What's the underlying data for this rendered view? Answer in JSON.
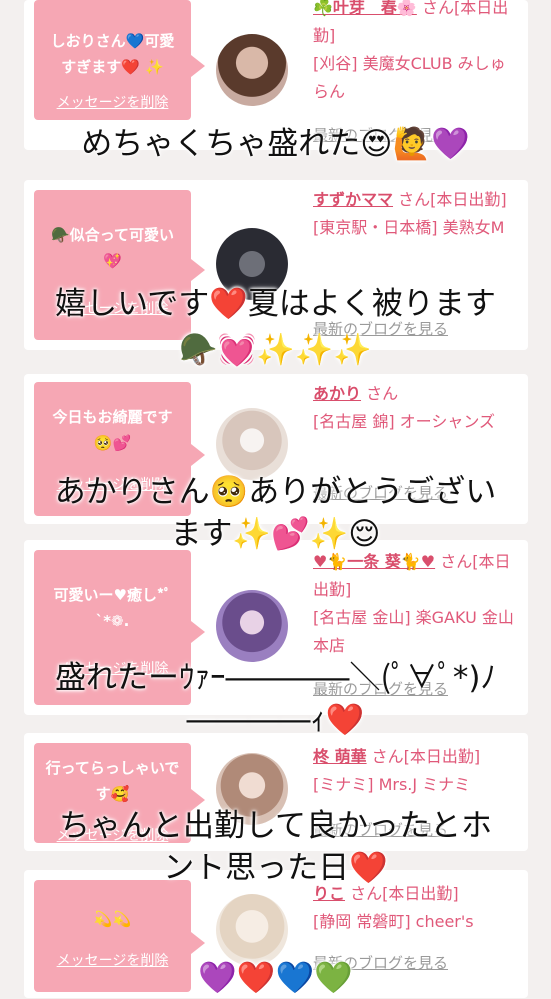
{
  "cards": [
    {
      "message": "しおりさん💙可愛すぎます❤️ ✨",
      "delete_label": "メッセージを削除",
      "name": "☘️叶芽　春🌸",
      "san": "さん[本日出勤]",
      "shop": "[刈谷] 美魔女CLUB みしゅらん",
      "blog_label": "最新のブログを見る"
    },
    {
      "message": "🪖似合って可愛い💖",
      "delete_label": "メッセージを削除",
      "name": "すずかママ",
      "san": "さん[本日出勤]",
      "shop": "[東京駅・日本橋] 美熟女M",
      "blog_label": "最新のブログを見る"
    },
    {
      "message": "今日もお綺麗です🥺💕",
      "delete_label": "メッセージを削除",
      "name": "あかり",
      "san": "さん",
      "shop": "[名古屋 錦] オーシャンズ",
      "blog_label": "最新のブログを見る"
    },
    {
      "message": "可愛いー♥癒し*ﾟ`*❁.",
      "delete_label": "メッセージを削除",
      "name": "♥🐈一条 葵🐈♥",
      "san": "さん[本日出勤]",
      "shop": "[名古屋 金山] 楽GAKU 金山本店",
      "blog_label": "最新のブログを見る"
    },
    {
      "message": "行ってらっしゃいです🥰",
      "delete_label": "メッセージを削除",
      "name": "柊 萌華",
      "san": "さん[本日出勤]",
      "shop": "[ミナミ] Mrs.J ミナミ",
      "blog_label": "最新のブログを見る"
    },
    {
      "message": "💫💫",
      "delete_label": "メッセージを削除",
      "name": "りこ",
      "san": "さん[本日出勤]",
      "shop": "[静岡 常磐町] cheer's",
      "blog_label": "最新のブログを見る"
    }
  ],
  "captions": [
    "めちゃくちゃ盛れた😍🙋💜",
    "嬉しいです❤️夏はよく被ります",
    "🪖💓✨✨✨",
    "あかりさん🥺ありがとうござい",
    "ます✨💕✨😌",
    "盛れたーｳｧｰ――――＼(ﾟ∀ﾟ*)ﾉ",
    "――――ｨ❤️",
    "ちゃんと出勤して良かったとホ",
    "ント思った日❤️",
    "💜❤️💙💚"
  ],
  "colors": {
    "bubble": "#f6a7b4",
    "name": "#d94e6c",
    "background": "#f3f0ef"
  }
}
